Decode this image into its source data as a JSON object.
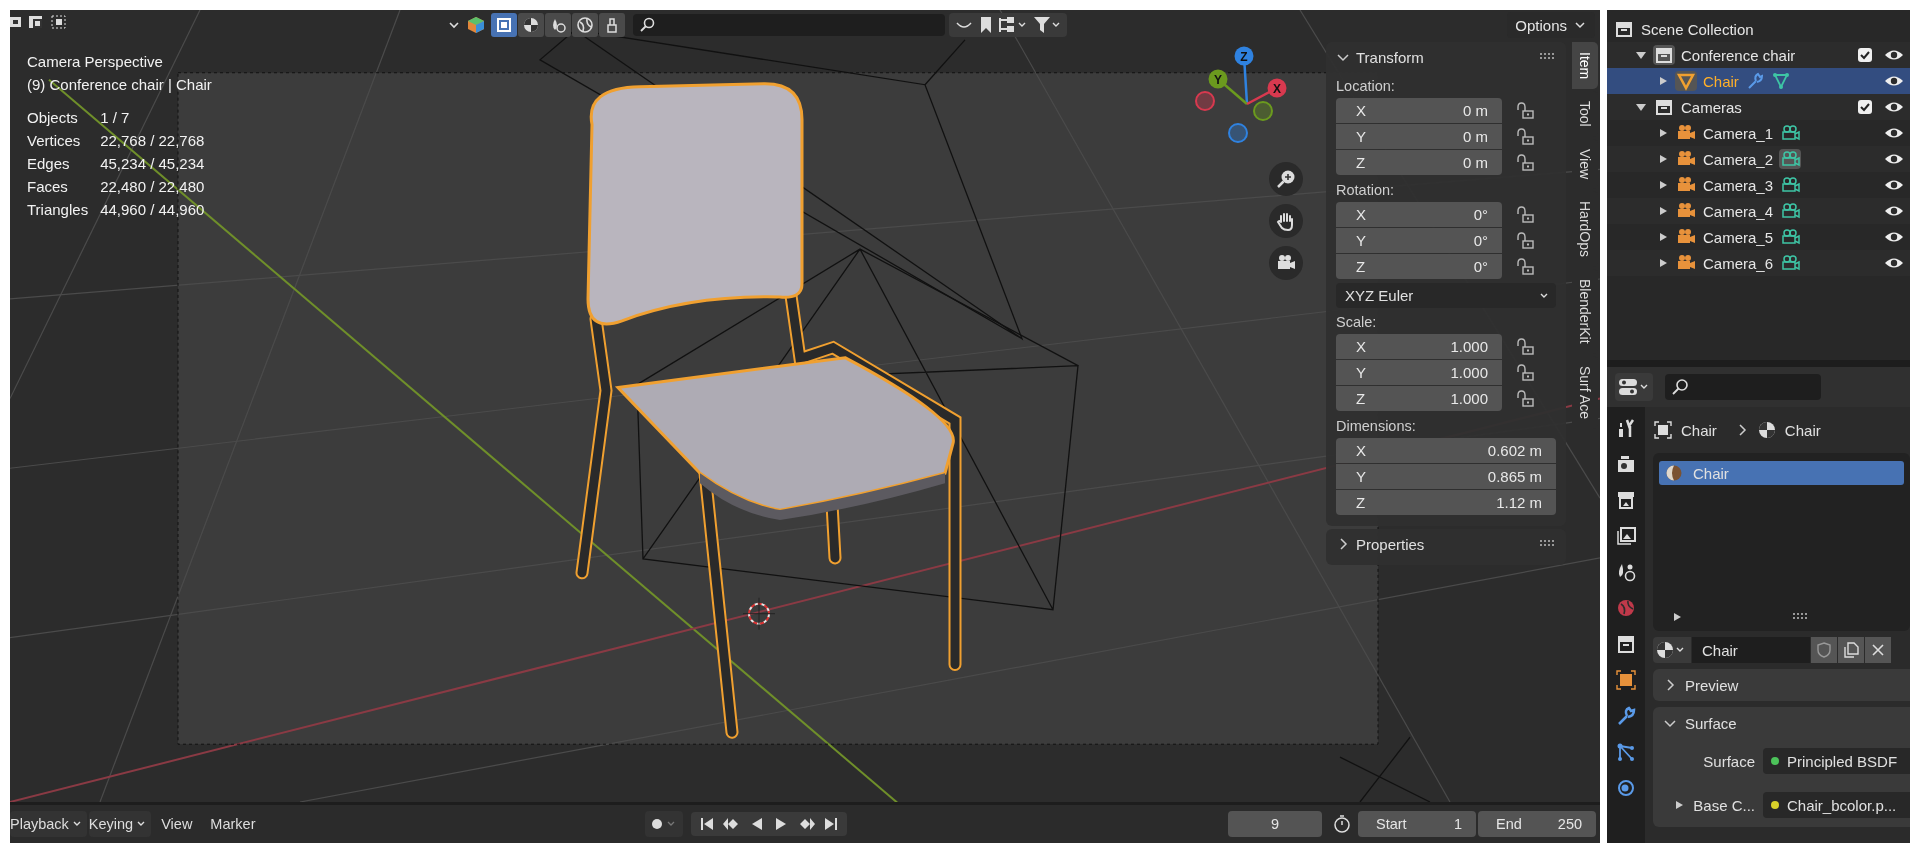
{
  "viewport": {
    "header": {
      "shading_buttons": [
        {
          "selected": true
        },
        {
          "selected": false
        },
        {
          "selected": false
        },
        {
          "selected": false
        },
        {
          "selected": false
        }
      ],
      "options": "Options"
    },
    "info": {
      "view": "Camera Perspective",
      "object": "(9) Conference chair | Chair",
      "stats": [
        {
          "label": "Objects",
          "value": "1 / 7"
        },
        {
          "label": "Vertices",
          "value": "22,768 / 22,768"
        },
        {
          "label": "Edges",
          "value": "45,234 / 45,234"
        },
        {
          "label": "Faces",
          "value": "22,480 / 22,480"
        },
        {
          "label": "Triangles",
          "value": "44,960 / 44,960"
        }
      ]
    },
    "gizmo_axes": [
      {
        "label": "Z",
        "color": "#2f82e0"
      },
      {
        "label": "Y",
        "color": "#6b9a1e"
      },
      {
        "label": "X",
        "color": "#d8394f"
      }
    ]
  },
  "sidebar": {
    "panels": [
      {
        "title": "Transform",
        "expanded": true,
        "groups": [
          {
            "kind": "vector",
            "label": "Location:",
            "fields": [
              {
                "axis": "X",
                "value": "0 m",
                "locked": false
              },
              {
                "axis": "Y",
                "value": "0 m",
                "locked": false
              },
              {
                "axis": "Z",
                "value": "0 m",
                "locked": false
              }
            ]
          },
          {
            "kind": "vector",
            "label": "Rotation:",
            "fields": [
              {
                "axis": "X",
                "value": "0°",
                "locked": false
              },
              {
                "axis": "Y",
                "value": "0°",
                "locked": false
              },
              {
                "axis": "Z",
                "value": "0°",
                "locked": false
              }
            ]
          },
          {
            "kind": "dropdown",
            "value": "XYZ Euler"
          },
          {
            "kind": "vector",
            "label": "Scale:",
            "fields": [
              {
                "axis": "X",
                "value": "1.000",
                "locked": false
              },
              {
                "axis": "Y",
                "value": "1.000",
                "locked": false
              },
              {
                "axis": "Z",
                "value": "1.000",
                "locked": false
              }
            ]
          },
          {
            "kind": "vector",
            "label": "Dimensions:",
            "fields": [
              {
                "axis": "X",
                "value": "0.602 m"
              },
              {
                "axis": "Y",
                "value": "0.865 m"
              },
              {
                "axis": "Z",
                "value": "1.12 m"
              }
            ]
          }
        ]
      },
      {
        "title": "Properties",
        "expanded": false
      }
    ],
    "tabs": [
      {
        "label": "Item",
        "selected": true
      },
      {
        "label": "Tool",
        "selected": false
      },
      {
        "label": "View",
        "selected": false
      },
      {
        "label": "HardOps",
        "selected": false
      },
      {
        "label": "BlenderKit",
        "selected": false
      },
      {
        "label": "Surf Ace",
        "selected": false
      }
    ]
  },
  "outliner": {
    "root": {
      "label": "Scene Collection",
      "kind": "scene",
      "children": [
        {
          "label": "Conference chair",
          "kind": "collection",
          "expanded": true,
          "checked": true,
          "selected": false,
          "children": [
            {
              "label": "Chair",
              "kind": "mesh",
              "expanded": false,
              "selected": true
            }
          ]
        },
        {
          "label": "Cameras",
          "kind": "collection",
          "expanded": true,
          "checked": true,
          "selected": false,
          "children": [
            {
              "label": "Camera_1",
              "kind": "camera",
              "expanded": false,
              "selected": false
            },
            {
              "label": "Camera_2",
              "kind": "camera",
              "expanded": false,
              "selected": false
            },
            {
              "label": "Camera_3",
              "kind": "camera",
              "expanded": false,
              "selected": false
            },
            {
              "label": "Camera_4",
              "kind": "camera",
              "expanded": false,
              "selected": false
            },
            {
              "label": "Camera_5",
              "kind": "camera",
              "expanded": false,
              "selected": false
            },
            {
              "label": "Camera_6",
              "kind": "camera",
              "expanded": false,
              "selected": false
            }
          ]
        }
      ]
    }
  },
  "properties": {
    "breadcrumb": [
      "Chair",
      "Chair"
    ],
    "slots": [
      {
        "name": "Chair",
        "selected": true
      }
    ],
    "material": "Chair",
    "panels": [
      {
        "title": "Preview",
        "expanded": false
      },
      {
        "title": "Surface",
        "expanded": true,
        "rows": [
          {
            "label": "Surface",
            "value": "Principled BSDF",
            "color": "#4cc35a"
          },
          {
            "label": "Base C...",
            "value": "Chair_bcolor.p...",
            "color": "#d8d02a",
            "expanded": false
          }
        ]
      }
    ]
  },
  "timeline": {
    "menus": [
      {
        "label": "Playback",
        "dropdown": true
      },
      {
        "label": "Keying",
        "dropdown": true
      },
      {
        "label": "View",
        "dropdown": false
      },
      {
        "label": "Marker",
        "dropdown": false
      }
    ],
    "frame": "9",
    "start": {
      "label": "Start",
      "value": "1"
    },
    "end": {
      "label": "End",
      "value": "250"
    }
  }
}
